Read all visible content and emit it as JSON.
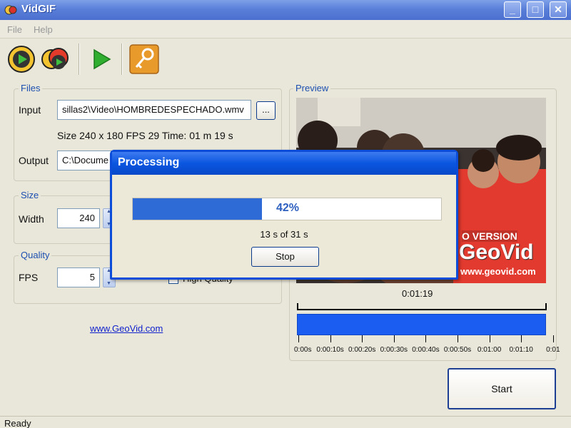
{
  "window": {
    "title": "VidGIF"
  },
  "menu": {
    "file": "File",
    "help": "Help"
  },
  "files": {
    "group_label": "Files",
    "input_label": "Input",
    "input_value": "sillas2\\Video\\HOMBREDESPECHADO.wmv",
    "browse_label": "...",
    "info": "Size  240 x 180  FPS 29  Time: 01 m 19 s",
    "output_label": "Output",
    "output_value": "C:\\Docume"
  },
  "size": {
    "group_label": "Size",
    "width_label": "Width",
    "width_value": "240"
  },
  "quality": {
    "group_label": "Quality",
    "fps_label": "FPS",
    "fps_value": "5",
    "high_quality_label": "High Quality"
  },
  "link": "www.GeoVid.com",
  "preview": {
    "group_label": "Preview",
    "watermark_line1": "O VERSION",
    "watermark_line2": "GeoVid",
    "watermark_line3": "www.geovid.com",
    "time_display": "0:01:19",
    "timeline_ticks": [
      "0:00s",
      "0:00:10s",
      "0:00:20s",
      "0:00:30s",
      "0:00:40s",
      "0:00:50s",
      "0:01:00",
      "0:01:10",
      "0:01"
    ]
  },
  "dialog": {
    "title": "Processing",
    "progress_fraction": 0.42,
    "progress_text": "42%",
    "status": "13 s of 31 s",
    "stop_label": "Stop"
  },
  "start_label": "Start",
  "status_bar": "Ready",
  "colors": {
    "titlebar": "#5a7fd9",
    "dialog_title": "#0a56e0",
    "progress": "#2f6bd6",
    "timeline": "#1a5df0",
    "link": "#1122cc"
  }
}
